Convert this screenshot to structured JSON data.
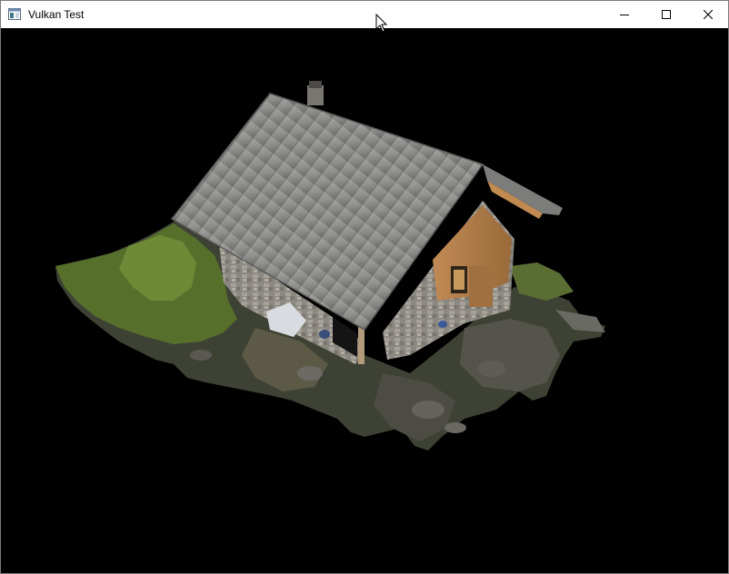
{
  "window": {
    "title": "Vulkan Test",
    "app_icon": "window-app-icon",
    "controls": {
      "minimize_icon": "minimize-icon",
      "maximize_icon": "maximize-icon",
      "close_icon": "close-icon"
    }
  },
  "viewport": {
    "background": "#000000",
    "content": "3d-rendered-model"
  },
  "colors": {
    "titlebar_bg": "#ffffff",
    "title_text": "#000000",
    "window_border": "#7a7a7a",
    "roof": "#8a8a88",
    "stone_wall": "#9a9690",
    "wood": "#b07a45",
    "grass": "#5e7a2e",
    "rock": "#4a4a46"
  }
}
